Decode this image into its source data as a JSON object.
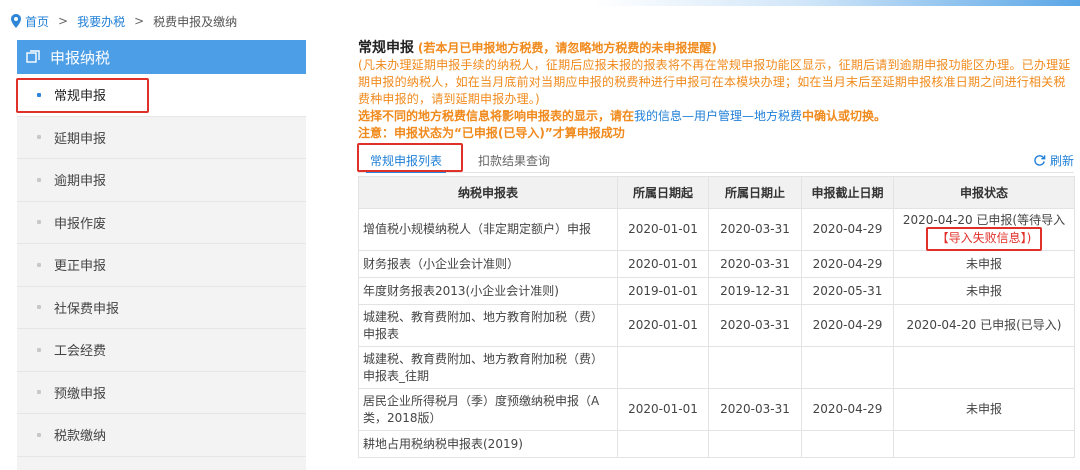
{
  "breadcrumb": {
    "home": "首页",
    "sep": ">",
    "level2": "我要办税",
    "level3": "税费申报及缴纳"
  },
  "sidebar": {
    "header": "申报纳税",
    "items": [
      {
        "label": "常规申报",
        "active": true
      },
      {
        "label": "延期申报"
      },
      {
        "label": "逾期申报"
      },
      {
        "label": "申报作废"
      },
      {
        "label": "更正申报"
      },
      {
        "label": "社保费申报"
      },
      {
        "label": "工会经费"
      },
      {
        "label": "预缴申报"
      },
      {
        "label": "税款缴纳"
      }
    ]
  },
  "main": {
    "title": "常规申报",
    "title_note": "(若本月已申报地方税费，请忽略地方税费的未申报提醒)",
    "notice": "(凡未办理延期申报手续的纳税人，征期后应报未报的报表将不再在常规申报功能区显示，征期后请到逾期申报功能区办理。已办理延期申报的纳税人，如在当月底前对当期应申报的税费种进行申报可在本模块办理；如在当月末后至延期申报核准日期之间进行相关税费种申报的，请到延期申报办理。)",
    "warn_prefix": "选择不同的地方税费信息将影响申报表的显示，请在",
    "warn_link": "我的信息—用户管理—地方税费",
    "warn_suffix": "中确认或切换。",
    "warn2": "注意：申报状态为“已申报(已导入)”才算申报成功"
  },
  "tabs": {
    "list": "常规申报列表",
    "deduct": "扣款结果查询",
    "refresh": "刷新"
  },
  "table": {
    "headers": [
      "纳税申报表",
      "所属日期起",
      "所属日期止",
      "申报截止日期",
      "申报状态"
    ],
    "rows": [
      {
        "name": "增值税小规模纳税人（非定期定额户）申报",
        "start": "2020-01-01",
        "end": "2020-03-31",
        "deadline": "2020-04-29",
        "status": "2020-04-20 已申报(等待导入",
        "status_link": "【导入失败信息】",
        "status_tail": ")"
      },
      {
        "name": "财务报表（小企业会计准则）",
        "start": "2020-01-01",
        "end": "2020-03-31",
        "deadline": "2020-04-29",
        "status": "未申报"
      },
      {
        "name": "年度财务报表2013(小企业会计准则)",
        "start": "2019-01-01",
        "end": "2019-12-31",
        "deadline": "2020-05-31",
        "status": "未申报"
      },
      {
        "name": "城建税、教育费附加、地方教育附加税（费）申报表",
        "start": "2020-01-01",
        "end": "2020-03-31",
        "deadline": "2020-04-29",
        "status": "2020-04-20 已申报(已导入)"
      },
      {
        "name": "城建税、教育费附加、地方教育附加税（费）申报表_往期",
        "start": "",
        "end": "",
        "deadline": "",
        "status": ""
      },
      {
        "name": "居民企业所得税月（季）度预缴纳税申报（A类，2018版）",
        "start": "2020-01-01",
        "end": "2020-03-31",
        "deadline": "2020-04-29",
        "status": "未申报"
      },
      {
        "name": "耕地占用税纳税申报表(2019)",
        "start": "",
        "end": "",
        "deadline": "",
        "status": ""
      }
    ]
  },
  "colors": {
    "accent": "#4c9ee6",
    "link": "#1f7fd6",
    "warning": "#f08a1c",
    "highlight": "#e0302a"
  }
}
